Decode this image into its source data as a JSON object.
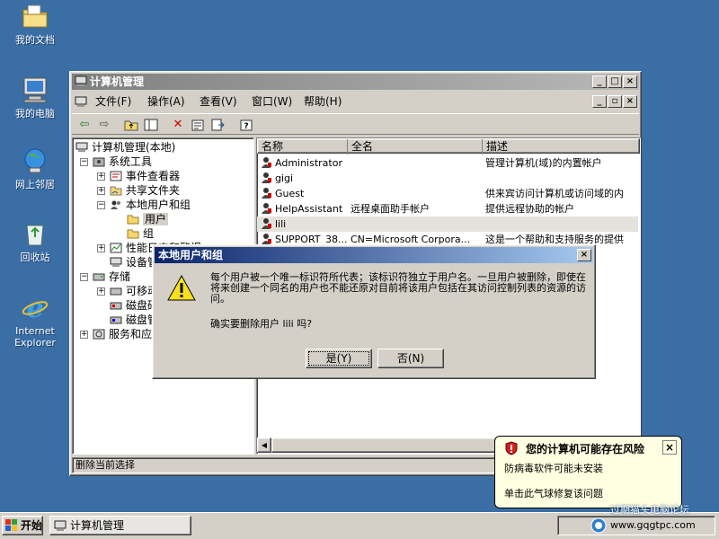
{
  "desktop": {
    "icons": [
      {
        "label": "我的文档"
      },
      {
        "label": "我的电脑"
      },
      {
        "label": "网上邻居"
      },
      {
        "label": "回收站"
      },
      {
        "label": "Internet Explorer"
      }
    ]
  },
  "window": {
    "title": "计算机管理",
    "menu": [
      "文件(F)",
      "操作(A)",
      "查看(V)",
      "窗口(W)",
      "帮助(H)"
    ],
    "tree": [
      {
        "label": "计算机管理(本地)"
      },
      {
        "label": "系统工具"
      },
      {
        "label": "事件查看器"
      },
      {
        "label": "共享文件夹"
      },
      {
        "label": "本地用户和组"
      },
      {
        "label": "用户"
      },
      {
        "label": "组"
      },
      {
        "label": "性能日志和警报"
      },
      {
        "label": "设备管理器"
      },
      {
        "label": "存储"
      },
      {
        "label": "可移动存储"
      },
      {
        "label": "磁盘碎片整理程序"
      },
      {
        "label": "磁盘管理"
      },
      {
        "label": "服务和应用程序"
      }
    ],
    "columns": [
      "名称",
      "全名",
      "描述"
    ],
    "rows": [
      {
        "name": "Administrator",
        "fullname": "",
        "desc": "管理计算机(域)的内置帐户"
      },
      {
        "name": "gigi",
        "fullname": "",
        "desc": ""
      },
      {
        "name": "Guest",
        "fullname": "",
        "desc": "供来宾访问计算机或访问域的内"
      },
      {
        "name": "HelpAssistant",
        "fullname": "远程桌面助手帐户",
        "desc": "提供远程协助的帐户"
      },
      {
        "name": "lili",
        "fullname": "",
        "desc": ""
      },
      {
        "name": "SUPPORT_38...",
        "fullname": "CN=Microsoft Corpora...",
        "desc": "这是一个帮助和支持服务的提供"
      }
    ],
    "status": "删除当前选择"
  },
  "dialog": {
    "title": "本地用户和组",
    "message": "每个用户被一个唯一标识符所代表；该标识符独立于用户名。一旦用户被删除，即使在将来创建一个同名的用户也不能还原对目前将该用户包括在其访问控制列表的资源的访问。",
    "question": "确实要删除用户 lili 吗?",
    "yes": "是(Y)",
    "no": "否(N)"
  },
  "balloon": {
    "title": "您的计算机可能存在风险",
    "line1": "防病毒软件可能未安装",
    "line2": "单击此气球修复该问题"
  },
  "taskbar": {
    "start": "开始",
    "task": "计算机管理",
    "watermark1": "过期猫头电脑论坛",
    "watermark2": "www.gqgtpc.com"
  },
  "colors": {
    "desktop": "#3a6ea5",
    "titlebar_active": "#0a246a",
    "face": "#d4d0c8"
  }
}
